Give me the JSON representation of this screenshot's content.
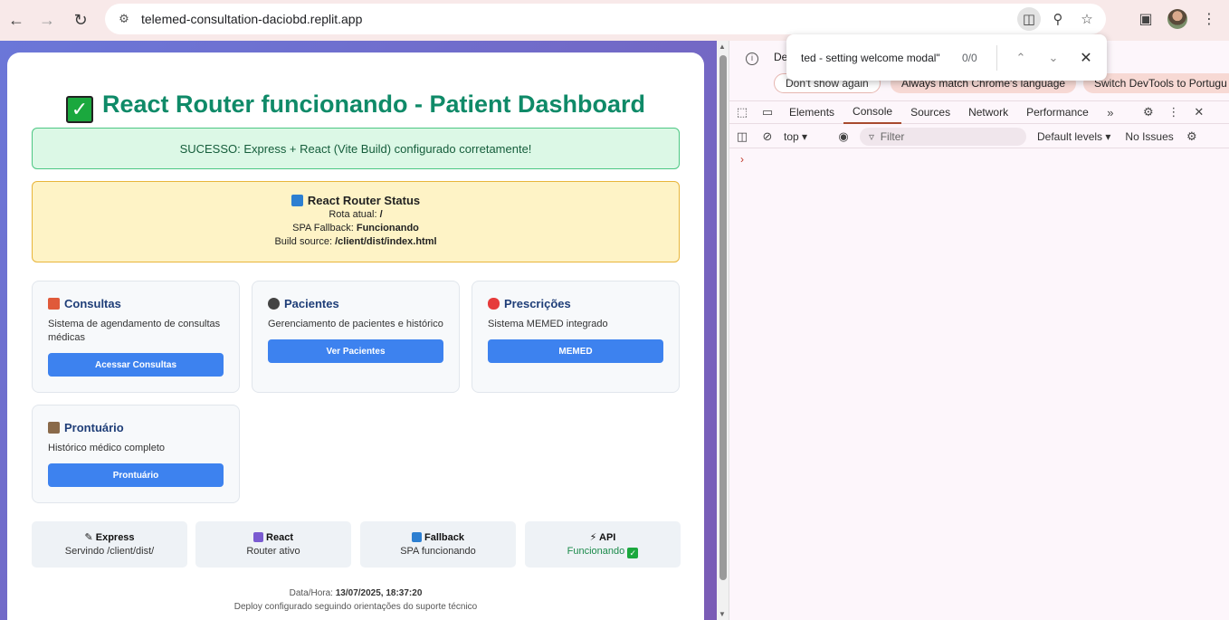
{
  "browser": {
    "url": "telemed-consultation-daciobd.replit.app",
    "find": {
      "query": "ted - setting welcome modal\"",
      "count": "0/0"
    }
  },
  "page": {
    "title": "React Router funcionando - Patient Dashboard",
    "success_message": "SUCESSO: Express + React (Vite Build) configurado corretamente!",
    "status": {
      "heading": "React Router Status",
      "route_label": "Rota atual:",
      "route_value": "/",
      "fallback_label": "SPA Fallback:",
      "fallback_value": "Funcionando",
      "build_label": "Build source:",
      "build_value": "/client/dist/index.html"
    },
    "features": [
      {
        "title": "Consultas",
        "desc": "Sistema de agendamento de consultas médicas",
        "button": "Acessar Consultas"
      },
      {
        "title": "Pacientes",
        "desc": "Gerenciamento de pacientes e histórico",
        "button": "Ver Pacientes"
      },
      {
        "title": "Prescrições",
        "desc": "Sistema MEMED integrado",
        "button": "MEMED"
      },
      {
        "title": "Prontuário",
        "desc": "Histórico médico completo",
        "button": "Prontuário"
      }
    ],
    "stats": [
      {
        "title": "Express",
        "value": "Servindo /client/dist/"
      },
      {
        "title": "React",
        "value": "Router ativo"
      },
      {
        "title": "Fallback",
        "value": "SPA funcionando"
      },
      {
        "title": "API",
        "value": "Funcionando"
      }
    ],
    "footer": {
      "datetime_label": "Data/Hora:",
      "datetime_value": "13/07/2025, 18:37:20",
      "note": "Deploy configurado seguindo orientações do suporte técnico"
    }
  },
  "devtools": {
    "info_text": "De",
    "dont_show": "Don't show again",
    "match_language": "Always match Chrome's language",
    "switch_lang": "Switch DevTools to Portugu",
    "tabs": [
      "Elements",
      "Console",
      "Sources",
      "Network",
      "Performance"
    ],
    "active_tab": "Console",
    "context": "top",
    "filter_placeholder": "Filter",
    "levels": "Default levels",
    "issues": "No Issues"
  },
  "colors": {
    "title_green": "#0f8a68",
    "button_blue": "#3d82ef",
    "success_bg": "#dcf8e6",
    "status_bg": "#fef3c6"
  }
}
